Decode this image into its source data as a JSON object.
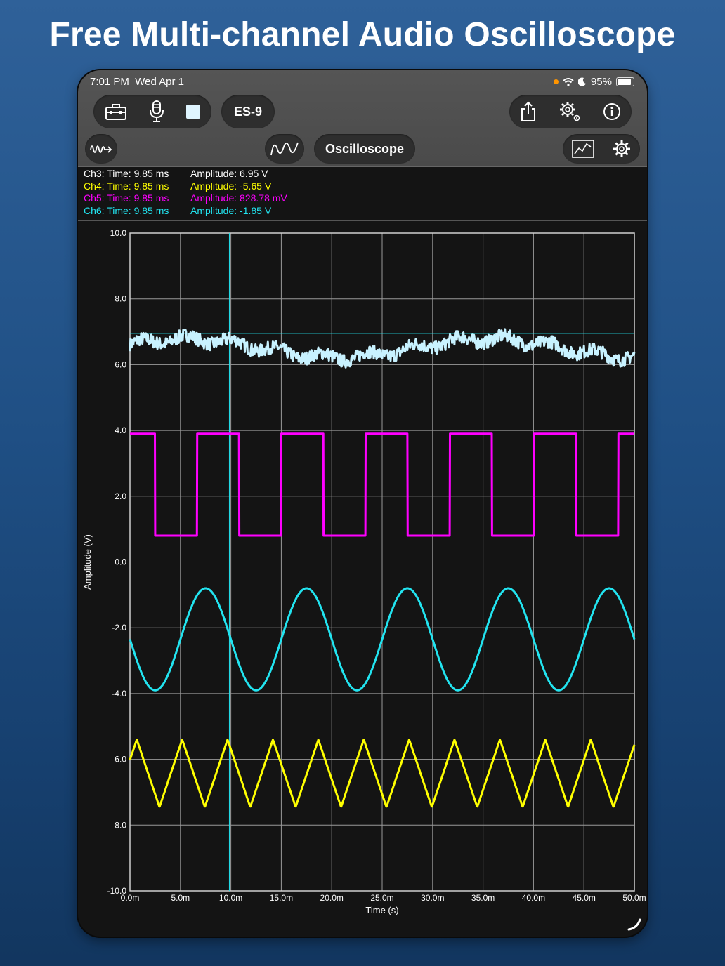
{
  "headline": "Free Multi-channel Audio Oscilloscope",
  "status_bar": {
    "time": "7:01 PM",
    "date": "Wed Apr 1",
    "battery": "95%"
  },
  "toolbar": {
    "device_label": "ES-9",
    "mode_label": "Oscilloscope"
  },
  "icons": {
    "toolbox": "toolbox-icon",
    "mic": "microphone-icon",
    "stop": "stop-icon",
    "share": "share-icon",
    "settings_gear": "settings-gear-icon",
    "info": "info-icon",
    "signal": "signal-wave-icon",
    "wave_mode": "sine-wave-icon",
    "chart": "chart-icon",
    "plot_settings": "gear-icon"
  },
  "readout": [
    {
      "channel": "Ch3:",
      "time": "Time: 9.85 ms",
      "amp": "Amplitude: 6.95 V",
      "color": "#ffffff"
    },
    {
      "channel": "Ch4:",
      "time": "Time: 9.85 ms",
      "amp": "Amplitude: -5.65 V",
      "color": "#ffff00"
    },
    {
      "channel": "Ch5:",
      "time": "Time: 9.85 ms",
      "amp": "Amplitude: 828.78 mV",
      "color": "#ff00ff"
    },
    {
      "channel": "Ch6:",
      "time": "Time: 9.85 ms",
      "amp": "Amplitude: -1.85 V",
      "color": "#22e4f0"
    }
  ],
  "chart_data": {
    "type": "line",
    "xlabel": "Time (s)",
    "ylabel": "Amplitude (V)",
    "xlim": [
      0,
      0.05
    ],
    "ylim": [
      -10,
      10
    ],
    "x_tick_labels": [
      "0.0m",
      "5.0m",
      "10.0m",
      "15.0m",
      "20.0m",
      "25.0m",
      "30.0m",
      "35.0m",
      "40.0m",
      "45.0m",
      "50.0m"
    ],
    "y_tick_labels": [
      "10.0",
      "8.0",
      "6.0",
      "4.0",
      "2.0",
      "0.0",
      "-2.0",
      "-4.0",
      "-6.0",
      "-8.0",
      "-10.0"
    ],
    "grid": true,
    "cursor_time": 0.00985,
    "cursor_level": 6.95,
    "series": [
      {
        "channel": "Ch3",
        "kind": "noise",
        "color": "#c8f2ff",
        "mean": 6.5,
        "range": [
          6.0,
          7.1
        ]
      },
      {
        "channel": "Ch4",
        "kind": "triangle",
        "color": "#ffff00",
        "min": -7.45,
        "max": -5.4,
        "period": 0.0045
      },
      {
        "channel": "Ch5",
        "kind": "square",
        "color": "#ff00ff",
        "low": 0.8,
        "high": 3.9,
        "period": 0.00835,
        "duty": 0.5
      },
      {
        "channel": "Ch6",
        "kind": "sine",
        "color": "#22e4f0",
        "offset": -2.35,
        "amplitude": 1.55,
        "period": 0.01
      }
    ]
  }
}
